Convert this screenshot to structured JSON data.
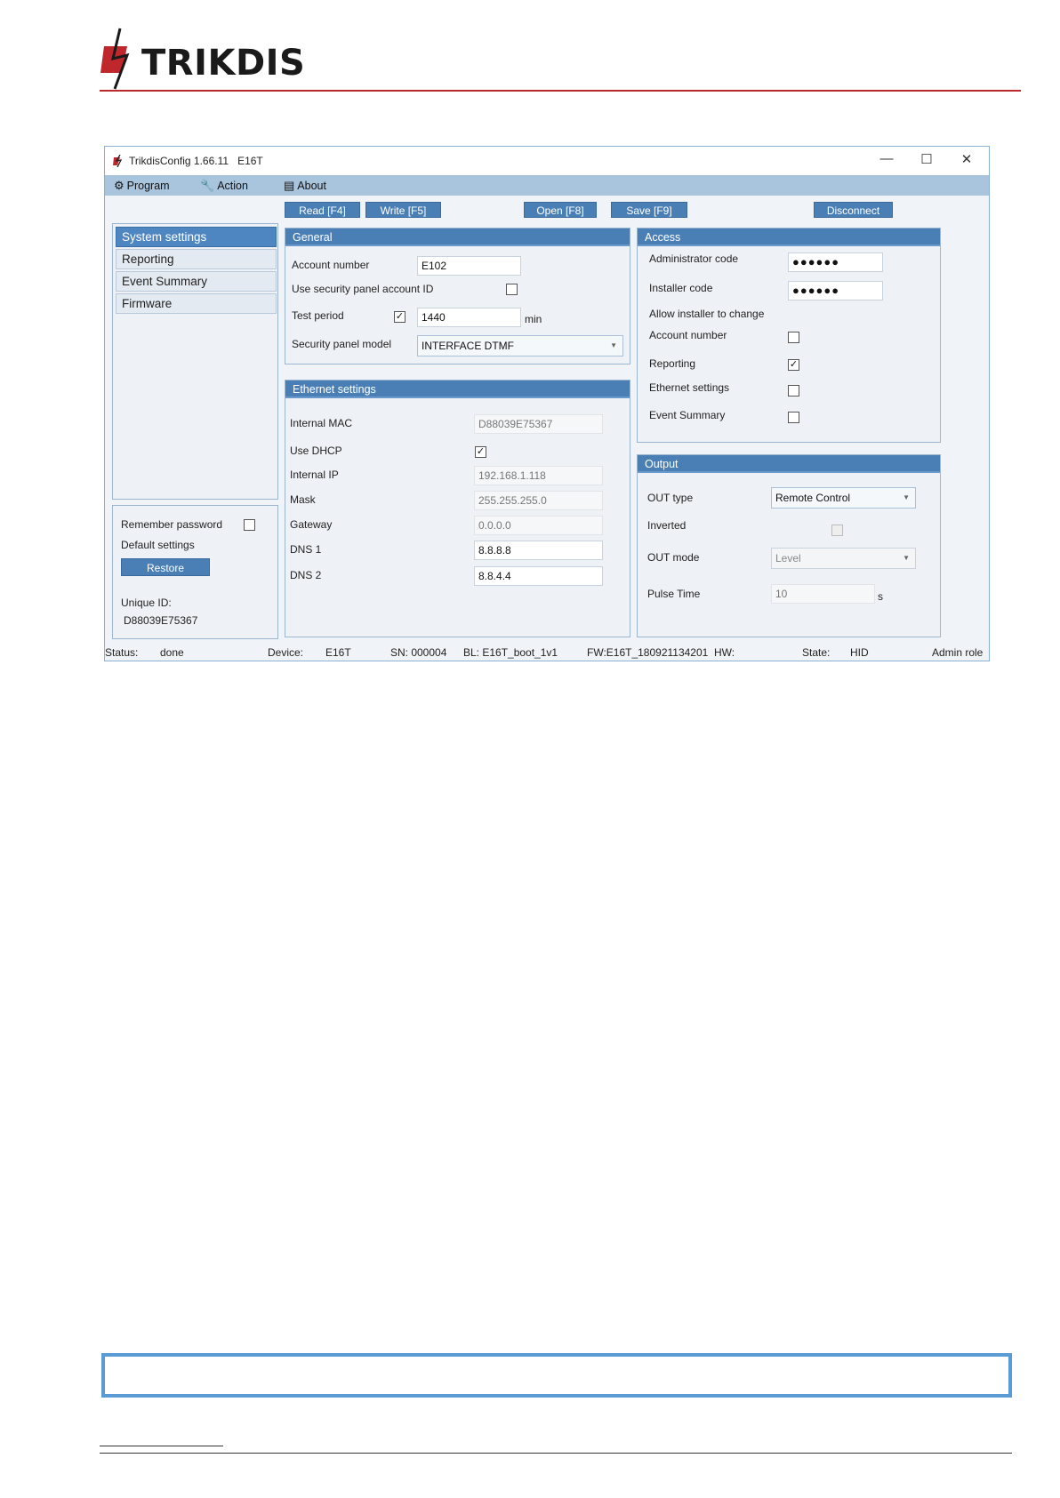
{
  "document": {
    "logo_text": "TRIKDIS",
    "brand_color": "#c0272d",
    "note_border_color": "#5b9bd5"
  },
  "window": {
    "title": "TrikdisConfig 1.66.11",
    "device_title": "E16T",
    "controls": {
      "minimize": "—",
      "maximize": "☐",
      "close": "✕"
    },
    "menu": [
      {
        "label": "Program",
        "icon": "gear-icon"
      },
      {
        "label": "Action",
        "icon": "wrench-icon"
      },
      {
        "label": "About",
        "icon": "keyboard-icon"
      }
    ],
    "toolbar": {
      "read": "Read [F4]",
      "write": "Write [F5]",
      "open": "Open [F8]",
      "save": "Save [F9]",
      "disconnect": "Disconnect"
    },
    "accent_color": "#4a7fb6"
  },
  "sidebar": {
    "items": [
      {
        "label": "System settings",
        "active": true
      },
      {
        "label": "Reporting",
        "active": false
      },
      {
        "label": "Event Summary",
        "active": false
      },
      {
        "label": "Firmware",
        "active": false
      }
    ],
    "remember_password": "Remember password",
    "remember_password_checked": false,
    "default_settings": "Default settings",
    "restore": "Restore",
    "unique_id_label": "Unique ID:",
    "unique_id": "D88039E75367"
  },
  "general": {
    "title": "General",
    "account_number_label": "Account number",
    "account_number": "E102",
    "use_panel_id_label": "Use security panel account ID",
    "use_panel_id_checked": false,
    "test_period_label": "Test period",
    "test_period_checked": true,
    "test_period": "1440",
    "test_period_unit": "min",
    "panel_model_label": "Security panel model",
    "panel_model": "INTERFACE DTMF"
  },
  "ethernet": {
    "title": "Ethernet settings",
    "mac_label": "Internal MAC",
    "mac": "D88039E75367",
    "dhcp_label": "Use DHCP",
    "dhcp_checked": true,
    "ip_label": "Internal IP",
    "ip": "192.168.1.118",
    "mask_label": "Mask",
    "mask": "255.255.255.0",
    "gateway_label": "Gateway",
    "gateway": "0.0.0.0",
    "dns1_label": "DNS 1",
    "dns1": "8.8.8.8",
    "dns2_label": "DNS 2",
    "dns2": "8.8.4.4"
  },
  "access": {
    "title": "Access",
    "admin_code_label": "Administrator code",
    "admin_code": "●●●●●●",
    "installer_code_label": "Installer code",
    "installer_code": "●●●●●●",
    "allow_label": "Allow installer to change",
    "items": [
      {
        "label": "Account number",
        "checked": false
      },
      {
        "label": "Reporting",
        "checked": true
      },
      {
        "label": "Ethernet settings",
        "checked": false
      },
      {
        "label": "Event Summary",
        "checked": false
      }
    ]
  },
  "output": {
    "title": "Output",
    "out_type_label": "OUT type",
    "out_type": "Remote Control",
    "inverted_label": "Inverted",
    "out_mode_label": "OUT mode",
    "out_mode": "Level",
    "pulse_time_label": "Pulse Time",
    "pulse_time": "10",
    "pulse_time_unit": "s"
  },
  "status": {
    "status_label": "Status:",
    "status": "done",
    "device_label": "Device:",
    "device": "E16T",
    "sn": "SN: 000004",
    "bl": "BL: E16T_boot_1v1",
    "fw": "FW:E16T_180921134201",
    "hw": "HW:",
    "state_label": "State:",
    "state": "HID",
    "role": "Admin role"
  }
}
